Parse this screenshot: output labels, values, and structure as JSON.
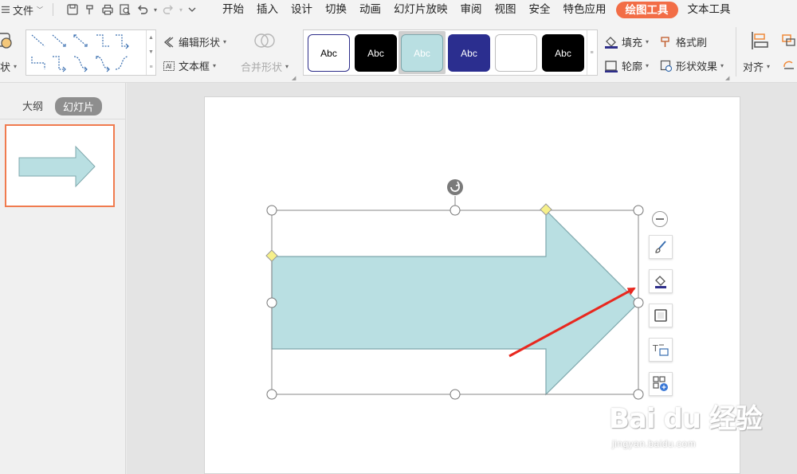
{
  "menubar": {
    "file_label": "文件",
    "tabs": [
      {
        "label": "开始"
      },
      {
        "label": "插入"
      },
      {
        "label": "设计"
      },
      {
        "label": "切换"
      },
      {
        "label": "动画"
      },
      {
        "label": "幻灯片放映"
      },
      {
        "label": "审阅"
      },
      {
        "label": "视图"
      },
      {
        "label": "安全"
      },
      {
        "label": "特色应用"
      },
      {
        "label": "绘图工具",
        "active": true
      },
      {
        "label": "文本工具"
      }
    ]
  },
  "ribbon": {
    "shapes_label": "状",
    "edit_shape": "编辑形状",
    "text_box": "文本框",
    "merge_shapes": "合并形状",
    "style_swatches": [
      {
        "label": "Abc",
        "bg": "#ffffff",
        "fg": "#000000",
        "border": "#2e2e8a"
      },
      {
        "label": "Abc",
        "bg": "#000000",
        "fg": "#ffffff",
        "border": "#000000"
      },
      {
        "label": "Abc",
        "bg": "#b9dfe2",
        "fg": "#ffffff",
        "border": "#7fa8ad"
      },
      {
        "label": "Abc",
        "bg": "#2b2e8f",
        "fg": "#ffffff",
        "border": "#2b2e8f"
      },
      {
        "label": "",
        "bg": "#ffffff",
        "fg": "#000000",
        "border": "#bdbdbd"
      },
      {
        "label": "Abc",
        "bg": "#000000",
        "fg": "#ffffff",
        "border": "#000000"
      }
    ],
    "fill": "填充",
    "format_painter": "格式刷",
    "outline": "轮廓",
    "shape_effects": "形状效果",
    "align": "对齐"
  },
  "panel": {
    "outline_tab": "大纲",
    "slides_tab": "幻灯片"
  },
  "colors": {
    "accent": "#f26d46",
    "arrow_fill": "#b9dfe2",
    "arrow_stroke": "#7fa8ad",
    "annotation_arrow": "#e8281f"
  },
  "watermark": {
    "main": "Bai du 经验",
    "sub": "jingyan.baidu.com"
  }
}
